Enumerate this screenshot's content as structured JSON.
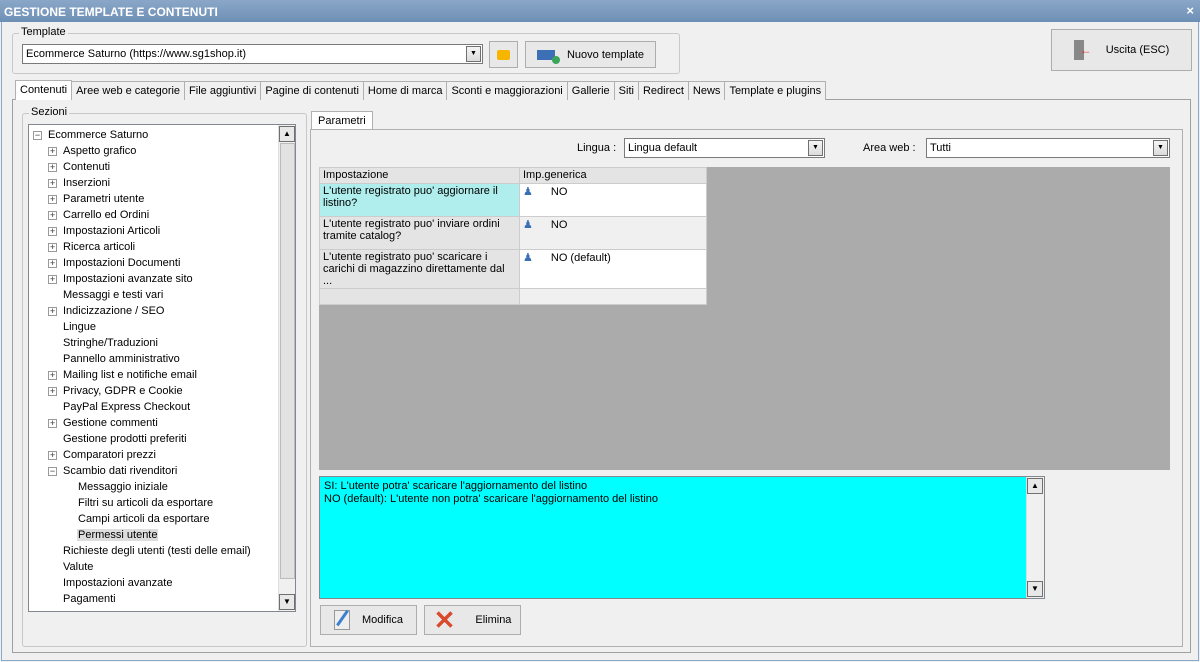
{
  "window": {
    "title": "GESTIONE TEMPLATE E CONTENUTI",
    "close": "×"
  },
  "template": {
    "legend": "Template",
    "value": "Ecommerce Saturno (https://www.sg1shop.it)",
    "new_label": "Nuovo template"
  },
  "exit_label": "Uscita (ESC)",
  "tabs": [
    "Contenuti",
    "Aree web e categorie",
    "File aggiuntivi",
    "Pagine di contenuti",
    "Home di marca",
    "Sconti e maggiorazioni",
    "Gallerie",
    "Siti",
    "Redirect",
    "News",
    "Template e plugins"
  ],
  "sections": {
    "legend": "Sezioni",
    "items": [
      {
        "label": "Ecommerce Saturno",
        "level": 0,
        "exp": "-"
      },
      {
        "label": "Aspetto grafico",
        "level": 1,
        "exp": "+"
      },
      {
        "label": "Contenuti",
        "level": 1,
        "exp": "+"
      },
      {
        "label": "Inserzioni",
        "level": 1,
        "exp": "+"
      },
      {
        "label": "Parametri utente",
        "level": 1,
        "exp": "+"
      },
      {
        "label": "Carrello ed Ordini",
        "level": 1,
        "exp": "+"
      },
      {
        "label": "Impostazioni Articoli",
        "level": 1,
        "exp": "+"
      },
      {
        "label": "Ricerca articoli",
        "level": 1,
        "exp": "+"
      },
      {
        "label": "Impostazioni Documenti",
        "level": 1,
        "exp": "+"
      },
      {
        "label": "Impostazioni avanzate sito",
        "level": 1,
        "exp": "+"
      },
      {
        "label": "Messaggi e testi vari",
        "level": 1,
        "exp": ""
      },
      {
        "label": "Indicizzazione / SEO",
        "level": 1,
        "exp": "+"
      },
      {
        "label": "Lingue",
        "level": 1,
        "exp": ""
      },
      {
        "label": "Stringhe/Traduzioni",
        "level": 1,
        "exp": ""
      },
      {
        "label": "Pannello amministrativo",
        "level": 1,
        "exp": ""
      },
      {
        "label": "Mailing list e notifiche email",
        "level": 1,
        "exp": "+"
      },
      {
        "label": "Privacy, GDPR e Cookie",
        "level": 1,
        "exp": "+"
      },
      {
        "label": "PayPal Express Checkout",
        "level": 1,
        "exp": ""
      },
      {
        "label": "Gestione commenti",
        "level": 1,
        "exp": "+"
      },
      {
        "label": "Gestione prodotti preferiti",
        "level": 1,
        "exp": ""
      },
      {
        "label": "Comparatori prezzi",
        "level": 1,
        "exp": "+"
      },
      {
        "label": "Scambio dati rivenditori",
        "level": 1,
        "exp": "-"
      },
      {
        "label": "Messaggio iniziale",
        "level": 2,
        "exp": ""
      },
      {
        "label": "Filtri su articoli da esportare",
        "level": 2,
        "exp": ""
      },
      {
        "label": "Campi articoli da esportare",
        "level": 2,
        "exp": ""
      },
      {
        "label": "Permessi utente",
        "level": 2,
        "exp": "",
        "selected": true
      },
      {
        "label": "Richieste degli utenti (testi delle email)",
        "level": 1,
        "exp": ""
      },
      {
        "label": "Valute",
        "level": 1,
        "exp": ""
      },
      {
        "label": "Impostazioni avanzate",
        "level": 1,
        "exp": ""
      },
      {
        "label": "Pagamenti",
        "level": 1,
        "exp": ""
      }
    ]
  },
  "params": {
    "tab": "Parametri",
    "lingua_label": "Lingua :",
    "lingua_value": "Lingua default",
    "area_label": "Area web :",
    "area_value": "Tutti",
    "columns": [
      "Impostazione",
      "Imp.generica"
    ],
    "rows": [
      {
        "setting": "L'utente registrato puo' aggiornare il listino?",
        "value": "NO",
        "selected": true
      },
      {
        "setting": "L'utente registrato puo' inviare ordini tramite catalog?",
        "value": "NO"
      },
      {
        "setting": "L'utente registrato puo' scaricare i carichi di magazzino direttamente dal ...",
        "value": "NO (default)"
      }
    ],
    "description": [
      "SI: L'utente potra' scaricare l'aggiornamento del listino",
      "NO (default): L'utente non potra' scaricare l'aggiornamento del listino"
    ],
    "edit_label": "Modifica",
    "delete_label": "Elimina"
  },
  "colors": {
    "titlebar": "#6e8fb5",
    "selected_row": "#b0eeee",
    "description_bg": "#00ffff",
    "grid_bg": "#ababab"
  }
}
